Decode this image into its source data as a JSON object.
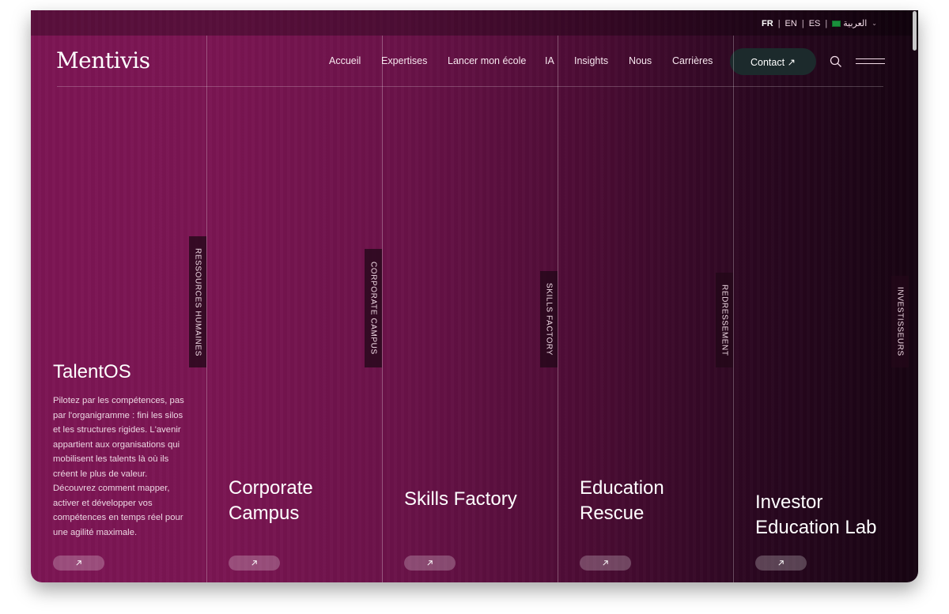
{
  "languages": {
    "items": [
      "FR",
      "EN",
      "ES",
      "العربية"
    ],
    "active": "FR"
  },
  "brand": {
    "logo": "Mentivis"
  },
  "nav": {
    "items": [
      "Accueil",
      "Expertises",
      "Lancer mon école",
      "IA",
      "Insights",
      "Nous",
      "Carrières"
    ],
    "contact_label": "Contact ↗"
  },
  "icons": {
    "search": "search-icon",
    "menu": "hamburger-menu-icon",
    "arrow": "arrow-up-right-icon"
  },
  "panels": [
    {
      "tab": "RESSOURCES HUMAINES",
      "title": "TalentOS",
      "description": "Pilotez par les compétences, pas par l'organigramme : fini les silos et les structures rigides. L'avenir appartient aux organisations qui mobilisent les talents là où ils créent le plus de valeur. Découvrez comment mapper, activer et développer vos compétences en temps réel pour une agilité maximale."
    },
    {
      "tab": "CORPORATE CAMPUS",
      "title": "Corporate Campus"
    },
    {
      "tab": "SKILLS FACTORY",
      "title": "Skills Factory"
    },
    {
      "tab": "REDRESSEMENT",
      "title": "Education Rescue"
    },
    {
      "tab": "INVESTISSEURS",
      "title": "Investor Education Lab"
    }
  ],
  "colors": {
    "background_start": "#7c1554",
    "background_end": "#160411",
    "contact_button": "#1c2a2c"
  }
}
